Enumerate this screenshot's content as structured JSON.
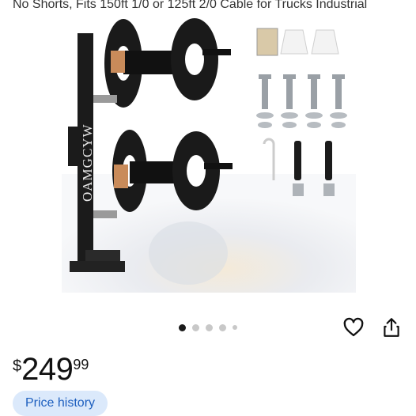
{
  "product": {
    "title_fragment": "No Shorts, Fits 150ft 1/0 or 125ft 2/0 Cable for Trucks Industrial",
    "brand_on_image": "OAMGCYW"
  },
  "gallery": {
    "image_count": 5,
    "active_index": 0
  },
  "actions": {
    "favorite_icon": "heart-icon",
    "share_icon": "share-icon"
  },
  "pricing": {
    "currency_symbol": "$",
    "whole": "249",
    "cents": "99",
    "price_history_label": "Price history"
  },
  "colors": {
    "accent_text": "#1d5fbf",
    "accent_bg": "#dbe9fb",
    "dot_active": "#1a1a1a",
    "dot_inactive": "#c8c8c8"
  }
}
